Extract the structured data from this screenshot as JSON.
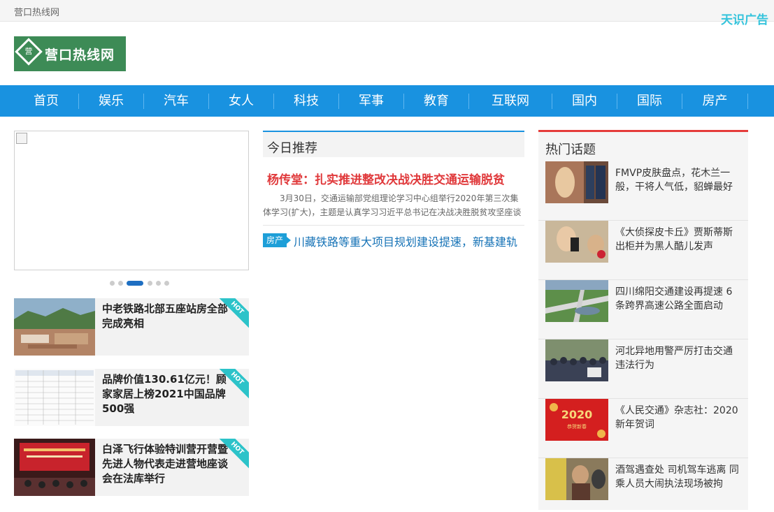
{
  "topbar": {
    "site_name": "营口热线网",
    "ad_text": "天识广告"
  },
  "logo": {
    "mark": "营",
    "name": "营口热线网",
    "color": "#3d8b56"
  },
  "nav": {
    "color": "#1992e0",
    "items": [
      "首页",
      "娱乐",
      "汽车",
      "女人",
      "科技",
      "军事",
      "教育",
      "互联网",
      "国内",
      "国际",
      "房产"
    ]
  },
  "left_cards": [
    {
      "title": "中老铁路北部五座站房全部完成亮相",
      "badge": "HOT"
    },
    {
      "title": "品牌价值130.61亿元！顾家家居上榜2021中国品牌500强",
      "badge": "HOT"
    },
    {
      "title": "白泽飞行体验特训营开营暨先进人物代表走进营地座谈会在法库举行",
      "badge": "HOT"
    }
  ],
  "today": {
    "section_title": "今日推荐",
    "headline": "杨传堂：扎实推进整改决战决胜交通运输脱贫",
    "summary": "3月30日，交通运输部党组理论学习中心组举行2020年第三次集体学习(扩大)，主题是认真学习习近平总书记在决战决胜脱贫攻坚座谈会",
    "tag": "房产",
    "tag_link": "川藏铁路等重大项目规划建设提速，新基建轨"
  },
  "hot_topics": {
    "title": "热门话题",
    "accent": "#e53c3a",
    "items": [
      {
        "text": "FMVP皮肤盘点，花木兰一般，干将人气低，貂蝉最好"
      },
      {
        "text": "《大侦探皮卡丘》贾斯蒂斯出柜并为黑人酷儿发声"
      },
      {
        "text": "四川绵阳交通建设再提速 6条跨界高速公路全面启动"
      },
      {
        "text": "河北异地用警严厉打击交通违法行为"
      },
      {
        "text": "《人民交通》杂志社：2020新年贺词"
      },
      {
        "text": "酒驾遇查处 司机驾车逃离 同乘人员大闹执法现场被拘"
      }
    ]
  },
  "thumb_texts": {
    "new_year_year": "2020",
    "new_year_greeting": "恭贺新春"
  }
}
